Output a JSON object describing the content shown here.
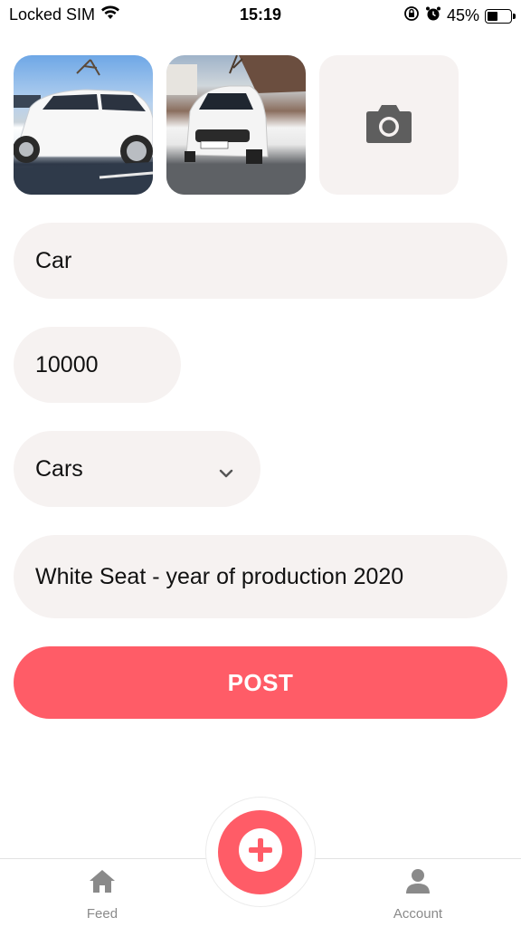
{
  "status_bar": {
    "carrier": "Locked SIM",
    "time": "15:19",
    "battery_percent_label": "45%",
    "battery_level": 0.45,
    "icons": [
      "wifi-icon",
      "rotation-lock-icon",
      "alarm-icon",
      "battery-icon"
    ]
  },
  "photos": {
    "items": [
      {
        "description_icon": "car-photo"
      },
      {
        "description_icon": "car-photo"
      }
    ],
    "add_photo_icon": "camera-icon"
  },
  "form": {
    "title_value": "Car",
    "price_value": "10000",
    "category_value": "Cars",
    "description_value": "White Seat - year of production 2020",
    "post_label": "POST"
  },
  "tab_bar": {
    "feed_label": "Feed",
    "account_label": "Account",
    "add_icon": "plus-icon"
  },
  "colors": {
    "accent": "#ff5c67",
    "field_background": "#f6f2f1",
    "tab_inactive": "#8a8a8a"
  }
}
